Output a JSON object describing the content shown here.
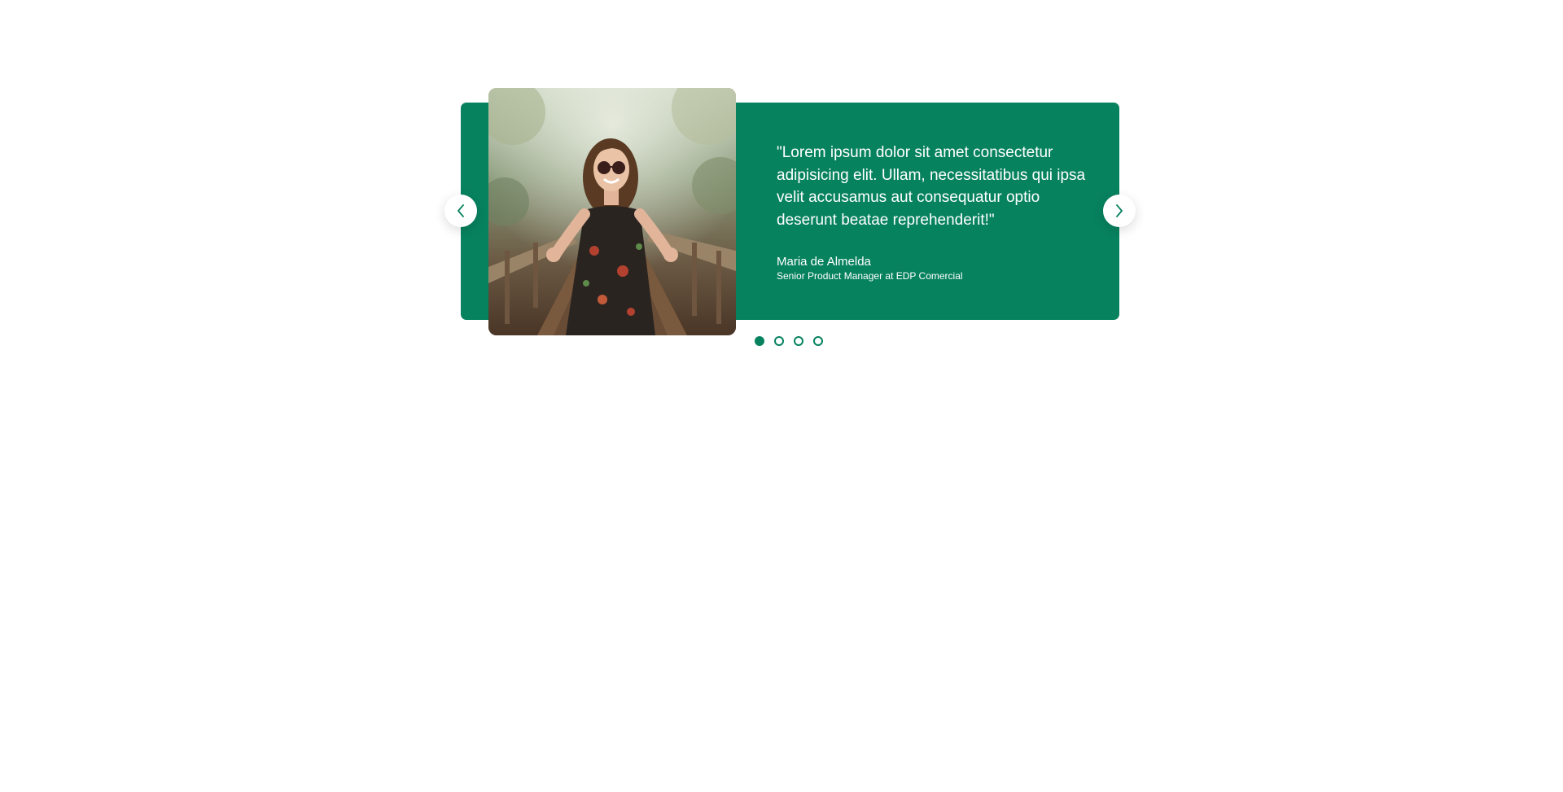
{
  "colors": {
    "accent": "#07825f",
    "text_on_accent": "#ffffff",
    "background": "#ffffff"
  },
  "testimonial": {
    "quote": "\"Lorem ipsum dolor sit amet consectetur adipisicing elit. Ullam, necessitatibus qui ipsa velit accusamus aut consequatur optio deserunt beatae reprehenderit!\"",
    "author_name": "Maria de Almelda",
    "author_role": "Senior Product Manager at EDP Comercial",
    "photo_icon": "person-photo"
  },
  "navigation": {
    "prev_icon": "chevron-left-icon",
    "next_icon": "chevron-right-icon"
  },
  "pagination": {
    "total": 4,
    "active_index": 0
  }
}
